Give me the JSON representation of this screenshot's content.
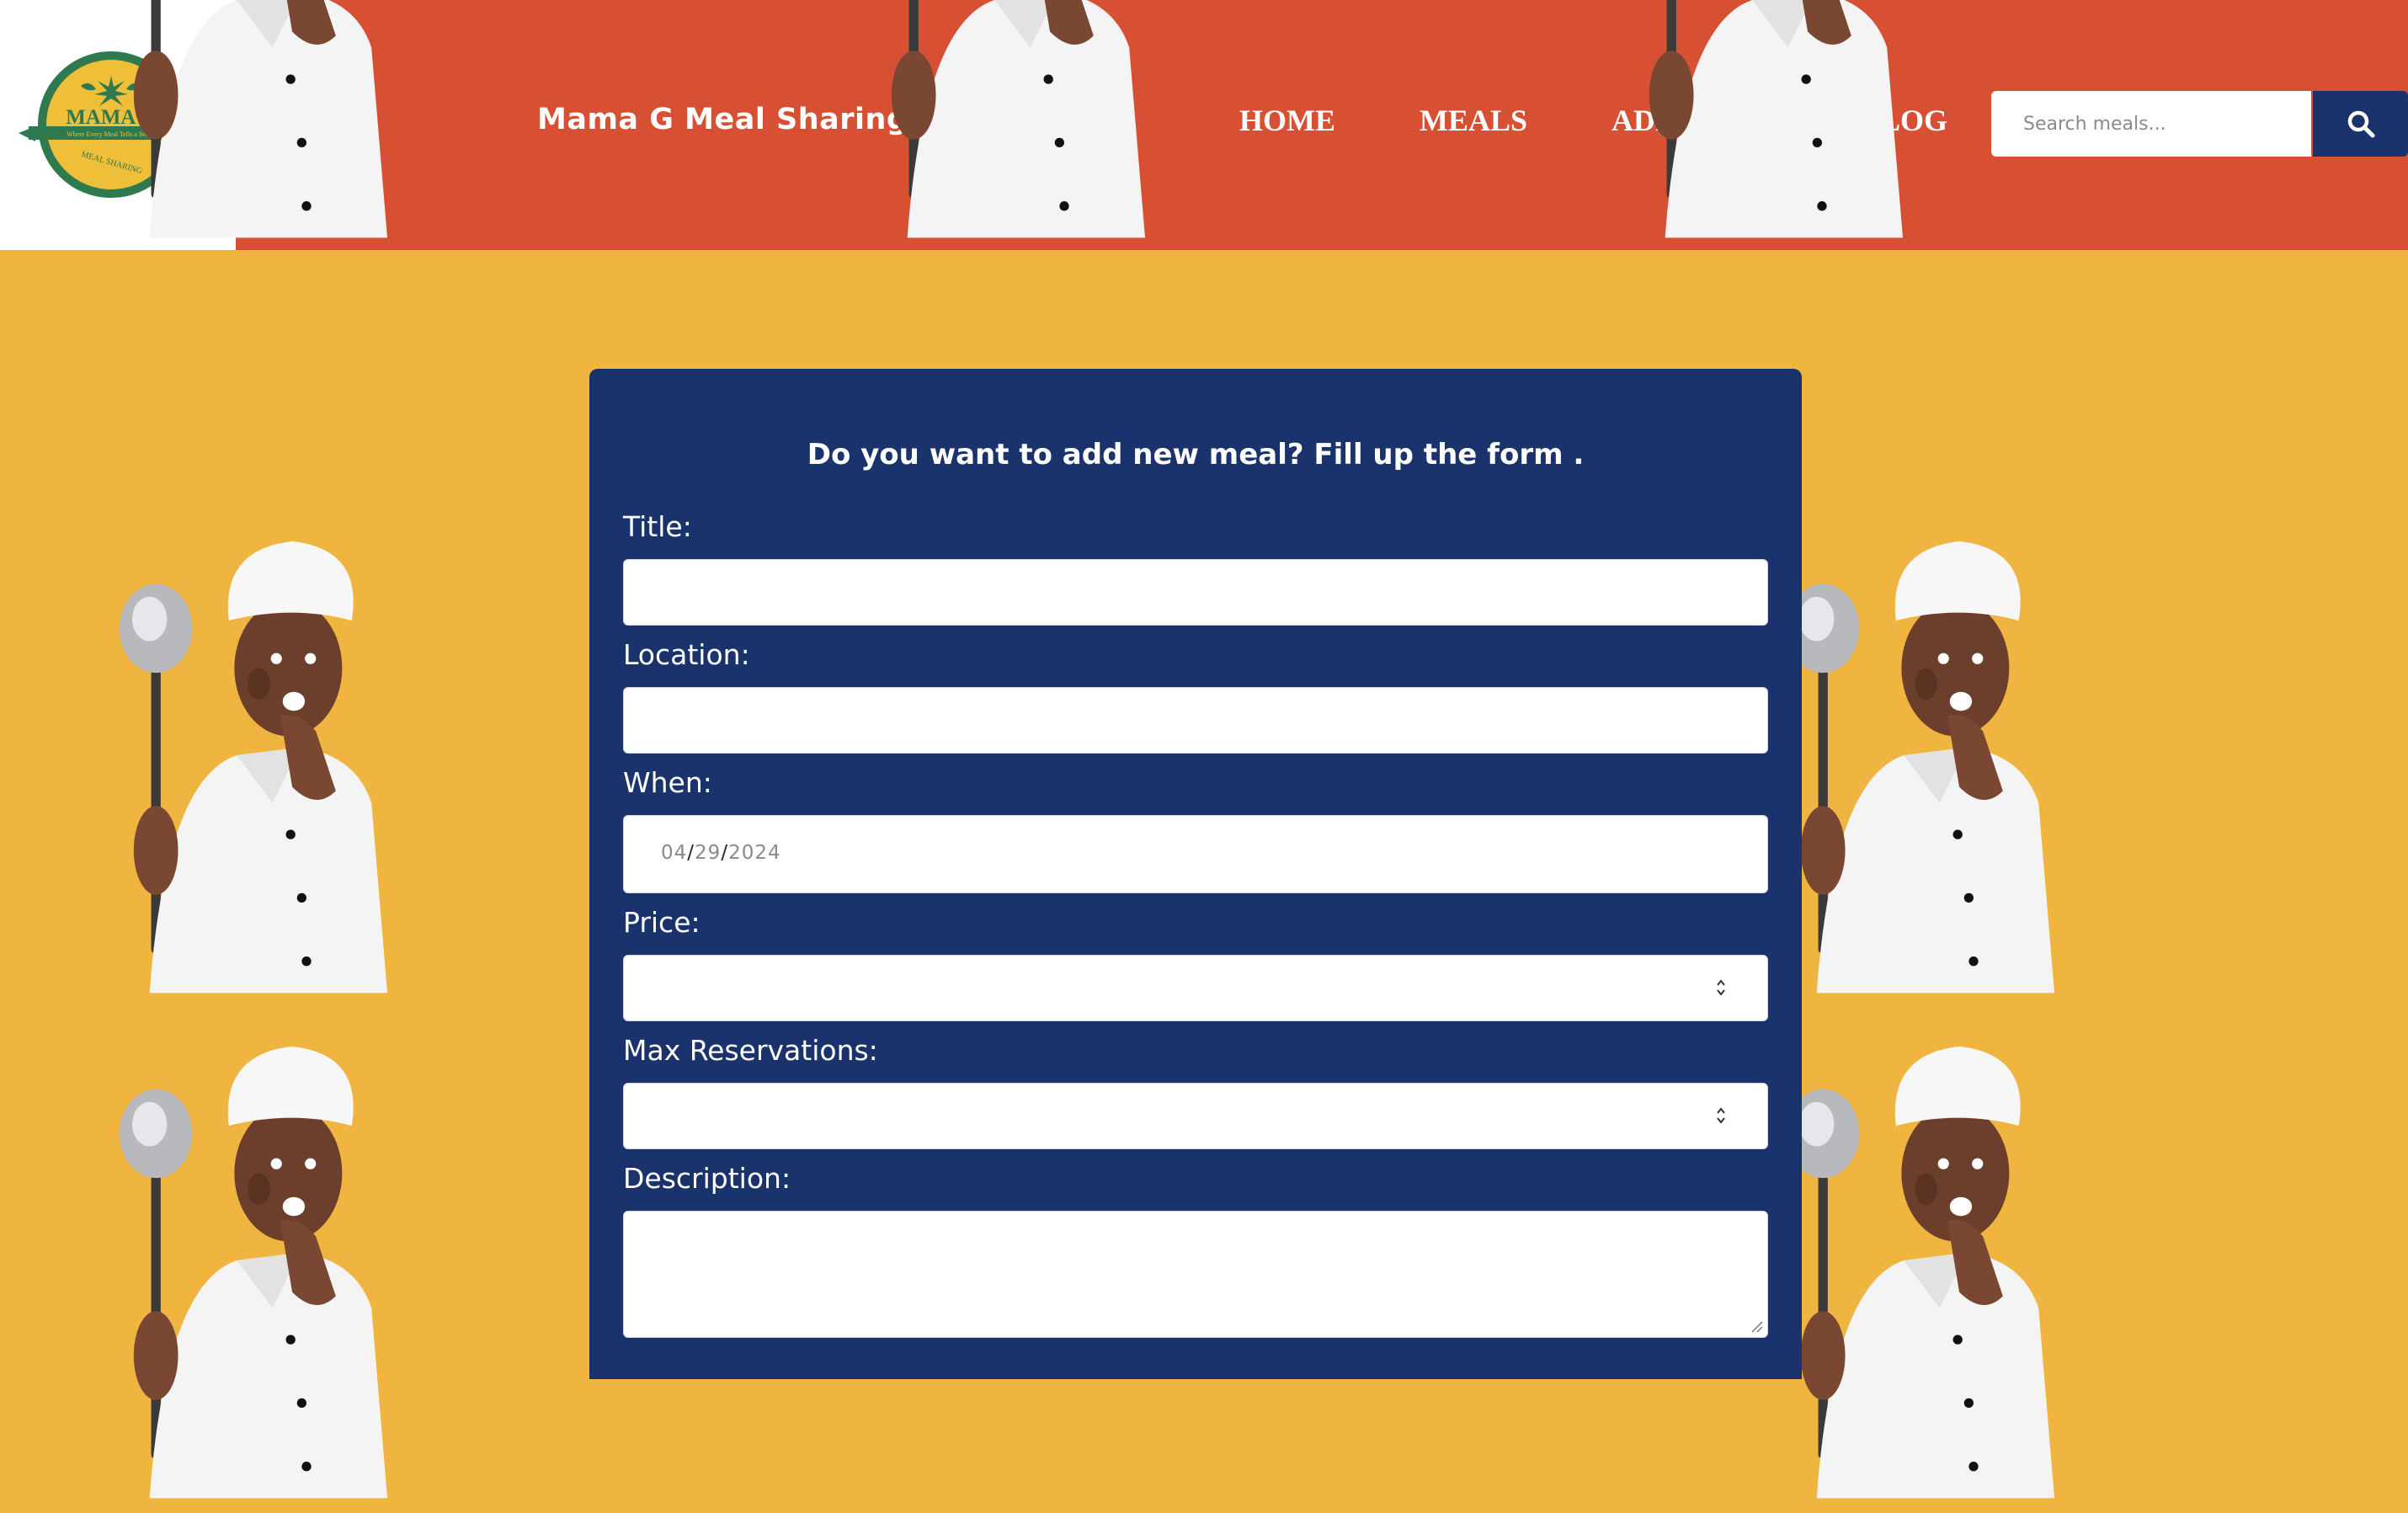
{
  "header": {
    "logo": {
      "main_text": "MAMA G",
      "tagline": "Where Every Meal Tells a Story!",
      "arc_text": "MEAL SHARING"
    },
    "site_title": "Mama G Meal Sharing!",
    "nav": [
      {
        "label": "HOME"
      },
      {
        "label": "MEALS"
      },
      {
        "label": "ADD MEAL"
      },
      {
        "label": "BLOG"
      }
    ],
    "search": {
      "placeholder": "Search meals...",
      "icon": "search-icon"
    }
  },
  "form": {
    "heading": "Do you want to add new meal? Fill up the form .",
    "title_label": "Title:",
    "location_label": "Location:",
    "when_label": "When:",
    "when_value": {
      "month": "04",
      "day": "29",
      "year": "2024",
      "separator": "/"
    },
    "price_label": "Price:",
    "max_reservations_label": "Max Reservations:",
    "description_label": "Description:"
  },
  "colors": {
    "header_bg": "#d85034",
    "page_bg": "#f0b540",
    "panel_bg": "#1a336c",
    "logo_green": "#2e7a4e",
    "logo_yellow": "#f0bf3a"
  }
}
